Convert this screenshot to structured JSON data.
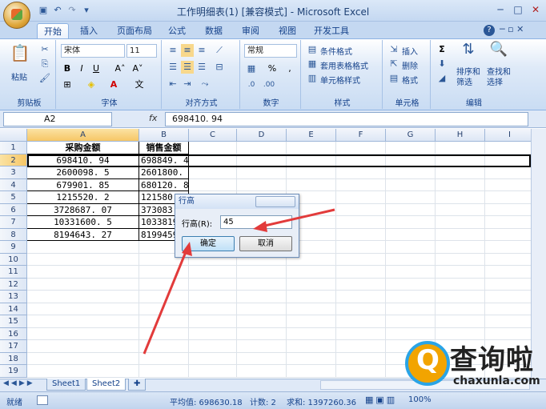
{
  "window": {
    "title": "工作明细表(1) [兼容模式] - Microsoft Excel",
    "min": "─",
    "max": "□",
    "close": "✕"
  },
  "tabs": [
    {
      "label": "开始"
    },
    {
      "label": "插入"
    },
    {
      "label": "页面布局"
    },
    {
      "label": "公式"
    },
    {
      "label": "数据"
    },
    {
      "label": "审阅"
    },
    {
      "label": "视图"
    },
    {
      "label": "开发工具"
    }
  ],
  "ribbon": {
    "clipboard": {
      "label": "剪贴板",
      "paste": "粘贴"
    },
    "font": {
      "label": "字体",
      "name": "宋体",
      "size": "11"
    },
    "alignment": {
      "label": "对齐方式"
    },
    "number": {
      "label": "数字",
      "format": "常规"
    },
    "styles": {
      "label": "样式",
      "conditional": "条件格式",
      "table": "套用表格格式",
      "cell": "单元格样式"
    },
    "cells": {
      "label": "单元格",
      "insert": "插入",
      "delete": "删除",
      "format": "格式"
    },
    "editing": {
      "label": "编辑",
      "sort": "排序和\n筛选",
      "find": "查找和\n选择"
    }
  },
  "formula_bar": {
    "name_box": "A2",
    "fx": "fx",
    "value": "698410. 94"
  },
  "columns": [
    "A",
    "B",
    "C",
    "D",
    "E",
    "F",
    "G",
    "H",
    "I"
  ],
  "rows": [
    "1",
    "2",
    "3",
    "4",
    "5",
    "6",
    "7",
    "8",
    "9",
    "10",
    "11",
    "12",
    "13",
    "14",
    "15",
    "16",
    "17",
    "18",
    "19"
  ],
  "table": {
    "headers": [
      "采购金额",
      "销售金额"
    ],
    "data": [
      [
        "698410. 94",
        "698849. 4"
      ],
      [
        "2600098. 5",
        "2601800."
      ],
      [
        "679901. 85",
        "680120. 8"
      ],
      [
        "1215520. 2",
        "121580"
      ],
      [
        "3728687. 07",
        "373083"
      ],
      [
        "10331600. 5",
        "1033819"
      ],
      [
        "8194643. 27",
        "8199459"
      ]
    ]
  },
  "sheets": [
    "Sheet1",
    "Sheet2"
  ],
  "status": {
    "ready": "就绪",
    "average": "平均值: 698630.18",
    "count": "计数: 2",
    "sum": "求和: 1397260.36",
    "zoom": "100%"
  },
  "dialog": {
    "title": "行高",
    "label": "行高(R):",
    "value": "45",
    "ok": "确定",
    "cancel": "取消"
  },
  "watermark": {
    "icon_letter": "Q",
    "text": "查询啦",
    "domain": "chaxunla.com"
  }
}
